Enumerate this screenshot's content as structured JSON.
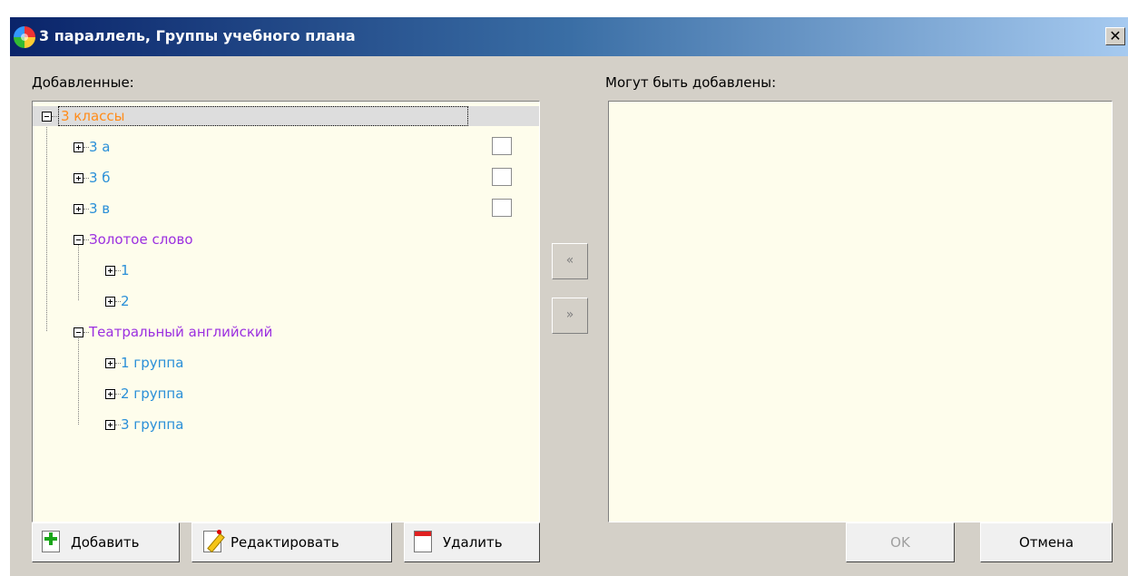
{
  "window": {
    "title": "3 параллель, Группы учебного плана",
    "close_glyph": "✕",
    "icon": "app-globe-icon"
  },
  "left_panel": {
    "label": "Добавленные:",
    "tree": [
      {
        "text": "3 классы",
        "level": 0,
        "expander": "minus",
        "color": "#ff8c1a",
        "selected": true
      },
      {
        "text": "3 а",
        "level": 1,
        "expander": "plus",
        "color": "#2a8fd8",
        "checkbox": false
      },
      {
        "text": "3 б",
        "level": 1,
        "expander": "plus",
        "color": "#2a8fd8",
        "checkbox": false
      },
      {
        "text": "3 в",
        "level": 1,
        "expander": "plus",
        "color": "#2a8fd8",
        "checkbox": false
      },
      {
        "text": "Золотое слово",
        "level": 1,
        "expander": "minus",
        "color": "#9b2fe0"
      },
      {
        "text": "1",
        "level": 2,
        "expander": "plus",
        "color": "#2a8fd8"
      },
      {
        "text": "2",
        "level": 2,
        "expander": "plus",
        "color": "#2a8fd8"
      },
      {
        "text": "Театральный английский",
        "level": 1,
        "expander": "minus",
        "color": "#9b2fe0"
      },
      {
        "text": "1 группа",
        "level": 2,
        "expander": "plus",
        "color": "#2a8fd8"
      },
      {
        "text": "2 группа",
        "level": 2,
        "expander": "plus",
        "color": "#2a8fd8"
      },
      {
        "text": "3 группа",
        "level": 2,
        "expander": "plus",
        "color": "#2a8fd8"
      }
    ]
  },
  "right_panel": {
    "label": "Могут быть добавлены:"
  },
  "transfer": {
    "move_left": "«",
    "move_right": "»"
  },
  "buttons": {
    "add": "Добавить",
    "edit": "Редактировать",
    "delete": "Удалить",
    "ok": "OK",
    "cancel": "Отмена"
  },
  "colors": {
    "panel_bg": "#fefdec",
    "dialog_bg": "#d4d0c8",
    "title_gradient_start": "#0a246a",
    "title_gradient_end": "#a6caf0"
  }
}
